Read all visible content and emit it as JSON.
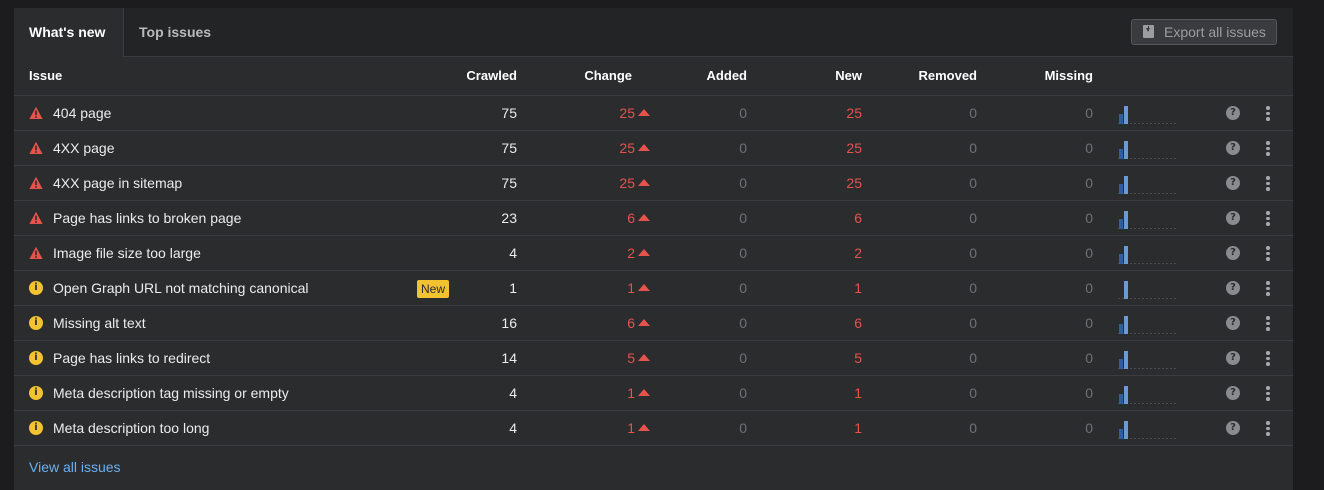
{
  "tabs": [
    {
      "label": "What's new",
      "active": true
    },
    {
      "label": "Top issues",
      "active": false
    }
  ],
  "export_button": {
    "label": "Export all issues",
    "icon": "download-icon"
  },
  "columns": {
    "issue": "Issue",
    "crawled": "Crawled",
    "change": "Change",
    "added": "Added",
    "new": "New",
    "removed": "Removed",
    "missing": "Missing"
  },
  "colors": {
    "error": "#e5534b",
    "warning": "#f2c230",
    "link": "#6ab0f3",
    "bar_dark": "#2f5f9e",
    "bar_light": "#6d9ad3"
  },
  "rows": [
    {
      "severity": "error",
      "issue": "404 page",
      "badge": "",
      "crawled": "75",
      "change": "25",
      "added": "0",
      "new": "25",
      "removed": "0",
      "missing": "0"
    },
    {
      "severity": "error",
      "issue": "4XX page",
      "badge": "",
      "crawled": "75",
      "change": "25",
      "added": "0",
      "new": "25",
      "removed": "0",
      "missing": "0"
    },
    {
      "severity": "error",
      "issue": "4XX page in sitemap",
      "badge": "",
      "crawled": "75",
      "change": "25",
      "added": "0",
      "new": "25",
      "removed": "0",
      "missing": "0"
    },
    {
      "severity": "error",
      "issue": "Page has links to broken page",
      "badge": "",
      "crawled": "23",
      "change": "6",
      "added": "0",
      "new": "6",
      "removed": "0",
      "missing": "0"
    },
    {
      "severity": "error",
      "issue": "Image file size too large",
      "badge": "",
      "crawled": "4",
      "change": "2",
      "added": "0",
      "new": "2",
      "removed": "0",
      "missing": "0"
    },
    {
      "severity": "warning",
      "issue": "Open Graph URL not matching canonical",
      "badge": "New",
      "crawled": "1",
      "change": "1",
      "added": "0",
      "new": "1",
      "removed": "0",
      "missing": "0"
    },
    {
      "severity": "warning",
      "issue": "Missing alt text",
      "badge": "",
      "crawled": "16",
      "change": "6",
      "added": "0",
      "new": "6",
      "removed": "0",
      "missing": "0"
    },
    {
      "severity": "warning",
      "issue": "Page has links to redirect",
      "badge": "",
      "crawled": "14",
      "change": "5",
      "added": "0",
      "new": "5",
      "removed": "0",
      "missing": "0"
    },
    {
      "severity": "warning",
      "issue": "Meta description tag missing or empty",
      "badge": "",
      "crawled": "4",
      "change": "1",
      "added": "0",
      "new": "1",
      "removed": "0",
      "missing": "0"
    },
    {
      "severity": "warning",
      "issue": "Meta description too long",
      "badge": "",
      "crawled": "4",
      "change": "1",
      "added": "0",
      "new": "1",
      "removed": "0",
      "missing": "0"
    }
  ],
  "footer": {
    "view_all": "View all issues"
  }
}
